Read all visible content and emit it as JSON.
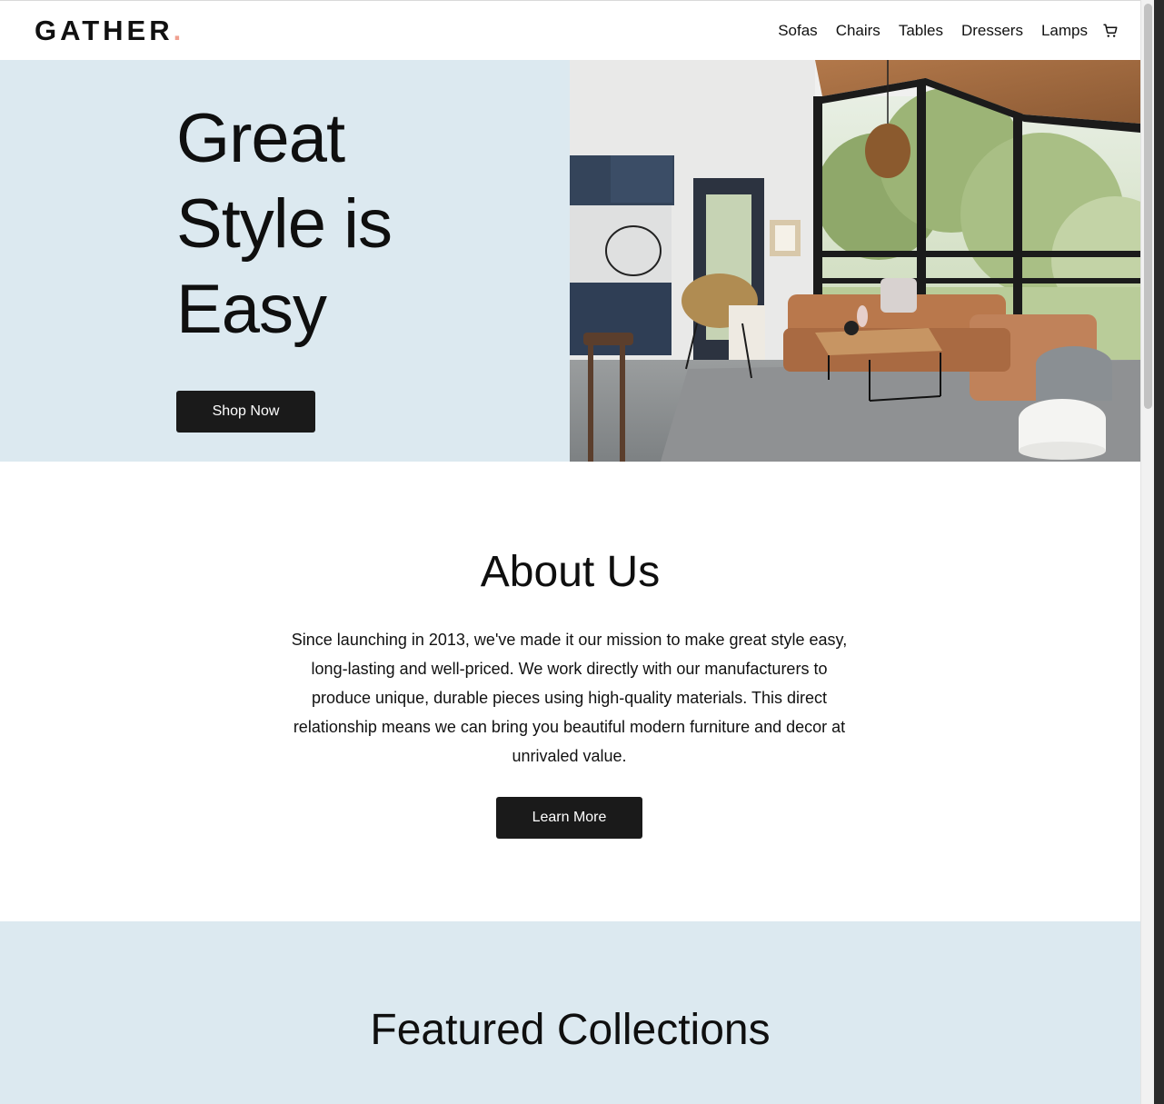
{
  "header": {
    "logo": "GATHER",
    "logo_dot": ".",
    "nav": [
      "Sofas",
      "Chairs",
      "Tables",
      "Dressers",
      "Lamps"
    ],
    "cart_icon": "cart-icon"
  },
  "hero": {
    "title_line1": "Great",
    "title_line2": "Style is",
    "title_line3": "Easy",
    "cta": "Shop Now",
    "image_alt": "Modern living room with leather sectional sofa"
  },
  "about": {
    "title": "About Us",
    "text": "Since launching in 2013, we've made it our mission to make great style easy, long-lasting and well-priced. We work directly with our manufacturers to produce unique, durable pieces using high-quality materials. This direct relationship means we can bring you beautiful modern furniture and decor at unrivaled value.",
    "cta": "Learn More"
  },
  "featured": {
    "title": "Featured Collections"
  },
  "colors": {
    "accent_dot": "#f0a090",
    "hero_bg": "#dce9f0",
    "button_bg": "#1a1a1a"
  }
}
